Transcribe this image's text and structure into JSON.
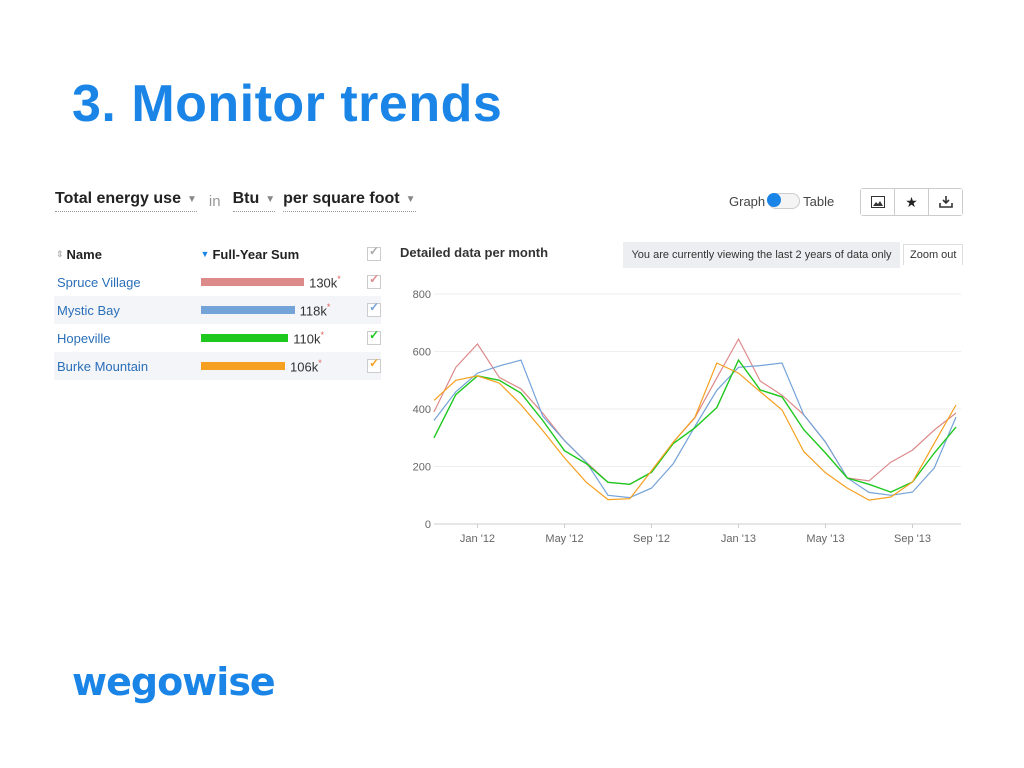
{
  "slide": {
    "title": "3. Monitor trends",
    "logo": "wegowise"
  },
  "controls": {
    "metric": "Total energy use",
    "connector": "in",
    "unit": "Btu",
    "normalization": "per square foot"
  },
  "view_toggle": {
    "left_label": "Graph",
    "right_label": "Table",
    "selected": "Graph"
  },
  "toolbar": {
    "buttons": [
      {
        "icon": "image-icon",
        "glyph": "▨"
      },
      {
        "icon": "star-icon",
        "glyph": "★"
      },
      {
        "icon": "download-icon",
        "glyph": "⤓"
      }
    ]
  },
  "table": {
    "headers": {
      "name": "Name",
      "sum": "Full-Year Sum"
    },
    "sort_name_glyph": "⇕",
    "sort_sum_glyph": "▼",
    "check_glyph": "✓",
    "rows": [
      {
        "name": "Spruce Village",
        "value": "130k",
        "fraction": 1.0,
        "color": "#dd8a8a",
        "marker": "*"
      },
      {
        "name": "Mystic Bay",
        "value": "118k",
        "fraction": 0.908,
        "color": "#74a3d8",
        "marker": "*"
      },
      {
        "name": "Hopeville",
        "value": "110k",
        "fraction": 0.846,
        "color": "#1ec81e",
        "marker": "*"
      },
      {
        "name": "Burke Mountain",
        "value": "106k",
        "fraction": 0.815,
        "color": "#f5a020",
        "marker": "*"
      }
    ]
  },
  "chart_panel": {
    "title": "Detailed data per month",
    "notice": "You are currently viewing the last 2 years of data only",
    "zoom_out_label": "Zoom out"
  },
  "chart_data": {
    "type": "line",
    "title": "Detailed data per month",
    "xlabel": "",
    "ylabel": "",
    "ylim": [
      0,
      800
    ],
    "yticks": [
      0,
      200,
      400,
      600,
      800
    ],
    "grid": true,
    "x": [
      "Nov '11",
      "Dec '11",
      "Jan '12",
      "Feb '12",
      "Mar '12",
      "Apr '12",
      "May '12",
      "Jun '12",
      "Jul '12",
      "Aug '12",
      "Sep '12",
      "Oct '12",
      "Nov '12",
      "Dec '12",
      "Jan '13",
      "Feb '13",
      "Mar '13",
      "Apr '13",
      "May '13",
      "Jun '13",
      "Jul '13",
      "Aug '13",
      "Sep '13",
      "Oct '13",
      "Nov '13"
    ],
    "xtick_labels": [
      {
        "index": 2,
        "label": "Jan '12"
      },
      {
        "index": 6,
        "label": "May '12"
      },
      {
        "index": 10,
        "label": "Sep '12"
      },
      {
        "index": 14,
        "label": "Jan '13"
      },
      {
        "index": 18,
        "label": "May '13"
      },
      {
        "index": 22,
        "label": "Sep '13"
      }
    ],
    "series": [
      {
        "name": "Spruce Village",
        "color": "#dd8a8a",
        "values": [
          390,
          545,
          626,
          510,
          470,
          385,
          290,
          215,
          145,
          138,
          180,
          285,
          370,
          508,
          643,
          497,
          448,
          380,
          285,
          160,
          150,
          215,
          257,
          327,
          386
        ]
      },
      {
        "name": "Mystic Bay",
        "color": "#74a3d8",
        "values": [
          360,
          460,
          525,
          550,
          570,
          375,
          290,
          215,
          100,
          92,
          125,
          210,
          340,
          465,
          545,
          551,
          560,
          380,
          285,
          160,
          110,
          100,
          111,
          195,
          372
        ]
      },
      {
        "name": "Hopeville",
        "color": "#1ec81e",
        "values": [
          300,
          450,
          515,
          500,
          455,
          360,
          255,
          210,
          145,
          138,
          180,
          280,
          335,
          405,
          570,
          466,
          442,
          328,
          247,
          160,
          138,
          111,
          146,
          247,
          337
        ]
      },
      {
        "name": "Burke Mountain",
        "color": "#f5a020",
        "values": [
          430,
          500,
          515,
          490,
          415,
          325,
          230,
          145,
          85,
          88,
          185,
          285,
          372,
          560,
          525,
          460,
          397,
          252,
          178,
          125,
          83,
          94,
          146,
          281,
          414
        ]
      }
    ]
  }
}
